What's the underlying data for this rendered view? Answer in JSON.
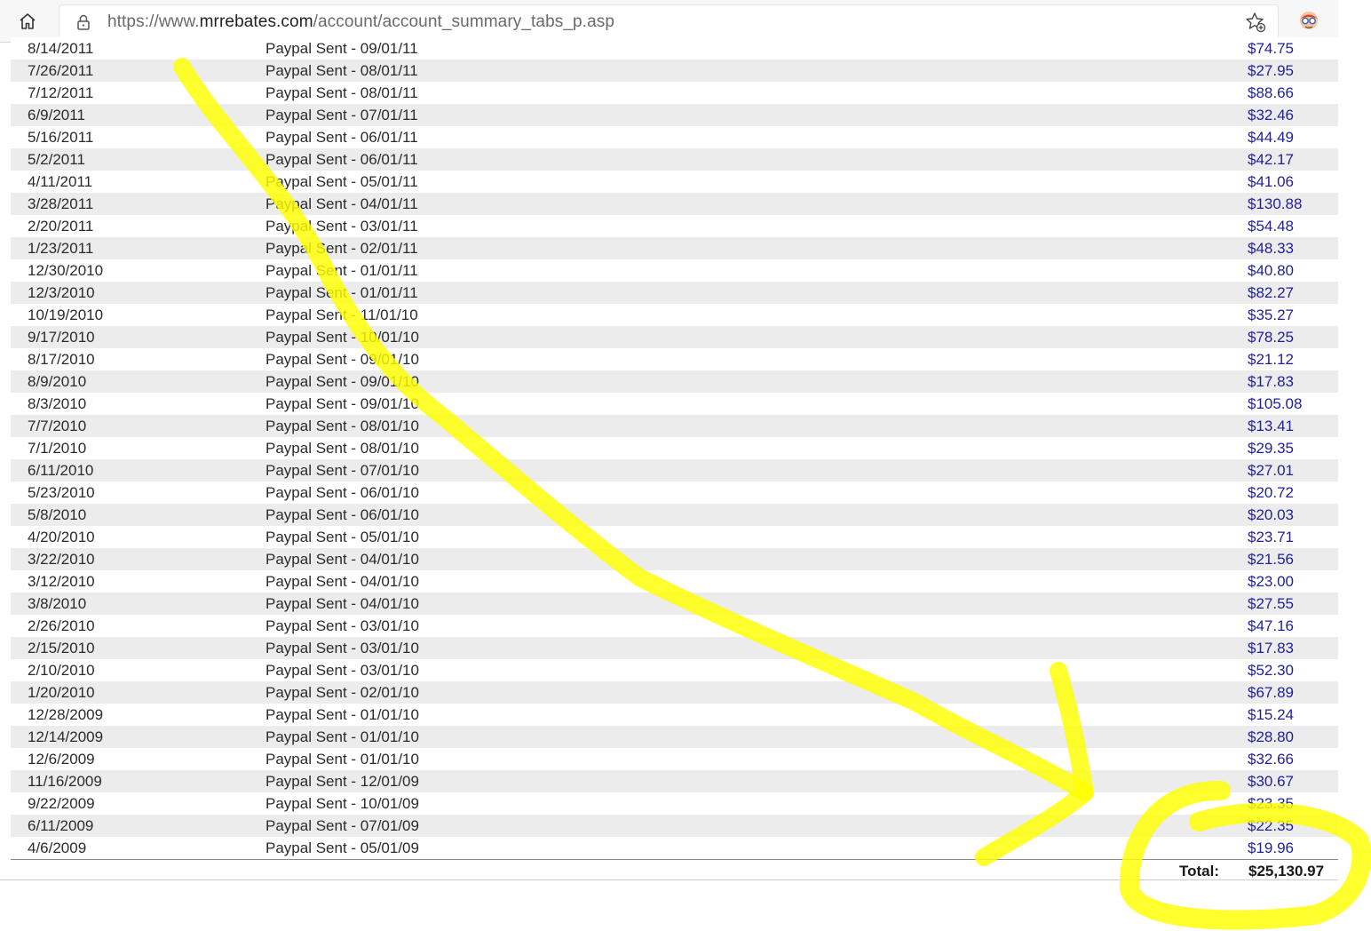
{
  "browser": {
    "url_prefix": "https://www.",
    "url_host": "mrrebates.com",
    "url_path": "/account/account_summary_tabs_p.asp"
  },
  "colors": {
    "amount_link": "#1f1f9e",
    "row_alt": "#ececec",
    "highlighter": "#ffff00"
  },
  "payments": {
    "rows": [
      {
        "date": "8/14/2011",
        "description": "Paypal Sent - 09/01/11",
        "amount": "$74.75"
      },
      {
        "date": "7/26/2011",
        "description": "Paypal Sent - 08/01/11",
        "amount": "$27.95"
      },
      {
        "date": "7/12/2011",
        "description": "Paypal Sent - 08/01/11",
        "amount": "$88.66"
      },
      {
        "date": "6/9/2011",
        "description": "Paypal Sent - 07/01/11",
        "amount": "$32.46"
      },
      {
        "date": "5/16/2011",
        "description": "Paypal Sent - 06/01/11",
        "amount": "$44.49"
      },
      {
        "date": "5/2/2011",
        "description": "Paypal Sent - 06/01/11",
        "amount": "$42.17"
      },
      {
        "date": "4/11/2011",
        "description": "Paypal Sent - 05/01/11",
        "amount": "$41.06"
      },
      {
        "date": "3/28/2011",
        "description": "Paypal Sent - 04/01/11",
        "amount": "$130.88"
      },
      {
        "date": "2/20/2011",
        "description": "Paypal Sent - 03/01/11",
        "amount": "$54.48"
      },
      {
        "date": "1/23/2011",
        "description": "Paypal Sent - 02/01/11",
        "amount": "$48.33"
      },
      {
        "date": "12/30/2010",
        "description": "Paypal Sent - 01/01/11",
        "amount": "$40.80"
      },
      {
        "date": "12/3/2010",
        "description": "Paypal Sent - 01/01/11",
        "amount": "$82.27"
      },
      {
        "date": "10/19/2010",
        "description": "Paypal Sent - 11/01/10",
        "amount": "$35.27"
      },
      {
        "date": "9/17/2010",
        "description": "Paypal Sent - 10/01/10",
        "amount": "$78.25"
      },
      {
        "date": "8/17/2010",
        "description": "Paypal Sent - 09/01/10",
        "amount": "$21.12"
      },
      {
        "date": "8/9/2010",
        "description": "Paypal Sent - 09/01/10",
        "amount": "$17.83"
      },
      {
        "date": "8/3/2010",
        "description": "Paypal Sent - 09/01/10",
        "amount": "$105.08"
      },
      {
        "date": "7/7/2010",
        "description": "Paypal Sent - 08/01/10",
        "amount": "$13.41"
      },
      {
        "date": "7/1/2010",
        "description": "Paypal Sent - 08/01/10",
        "amount": "$29.35"
      },
      {
        "date": "6/11/2010",
        "description": "Paypal Sent - 07/01/10",
        "amount": "$27.01"
      },
      {
        "date": "5/23/2010",
        "description": "Paypal Sent - 06/01/10",
        "amount": "$20.72"
      },
      {
        "date": "5/8/2010",
        "description": "Paypal Sent - 06/01/10",
        "amount": "$20.03"
      },
      {
        "date": "4/20/2010",
        "description": "Paypal Sent - 05/01/10",
        "amount": "$23.71"
      },
      {
        "date": "3/22/2010",
        "description": "Paypal Sent - 04/01/10",
        "amount": "$21.56"
      },
      {
        "date": "3/12/2010",
        "description": "Paypal Sent - 04/01/10",
        "amount": "$23.00"
      },
      {
        "date": "3/8/2010",
        "description": "Paypal Sent - 04/01/10",
        "amount": "$27.55"
      },
      {
        "date": "2/26/2010",
        "description": "Paypal Sent - 03/01/10",
        "amount": "$47.16"
      },
      {
        "date": "2/15/2010",
        "description": "Paypal Sent - 03/01/10",
        "amount": "$17.83"
      },
      {
        "date": "2/10/2010",
        "description": "Paypal Sent - 03/01/10",
        "amount": "$52.30"
      },
      {
        "date": "1/20/2010",
        "description": "Paypal Sent - 02/01/10",
        "amount": "$67.89"
      },
      {
        "date": "12/28/2009",
        "description": "Paypal Sent - 01/01/10",
        "amount": "$15.24"
      },
      {
        "date": "12/14/2009",
        "description": "Paypal Sent - 01/01/10",
        "amount": "$28.80"
      },
      {
        "date": "12/6/2009",
        "description": "Paypal Sent - 01/01/10",
        "amount": "$32.66"
      },
      {
        "date": "11/16/2009",
        "description": "Paypal Sent - 12/01/09",
        "amount": "$30.67"
      },
      {
        "date": "9/22/2009",
        "description": "Paypal Sent - 10/01/09",
        "amount": "$23.35"
      },
      {
        "date": "6/11/2009",
        "description": "Paypal Sent - 07/01/09",
        "amount": "$22.35"
      },
      {
        "date": "4/6/2009",
        "description": "Paypal Sent - 05/01/09",
        "amount": "$19.96"
      }
    ],
    "total_label": "Total:",
    "total_value": "$25,130.97"
  }
}
